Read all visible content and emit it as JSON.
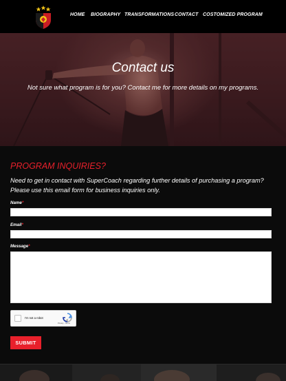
{
  "header": {
    "nav": [
      {
        "id": "home",
        "label": "HOME"
      },
      {
        "id": "biography",
        "label": "BIOGRAPHY"
      },
      {
        "id": "transformations",
        "label": "TRANSFORMATIONS"
      },
      {
        "id": "contact",
        "label": "CONTACT"
      },
      {
        "id": "customized",
        "label": "COSTOMIZED PROGRAM"
      }
    ],
    "logo_icon": "crest-logo-icon"
  },
  "hero": {
    "title": "Contact us",
    "subtitle": "Not sure what program is for you? Contact me for more details on my programs."
  },
  "form": {
    "title": "PROGRAM INQUIRIES?",
    "description": "Need to get in contact with SuperCoach regarding further details of purchasing a program? Please use this email form for business inquiries only.",
    "name_label": "Name",
    "email_label": "Email",
    "message_label": "Message",
    "required_mark": "*",
    "name_value": "",
    "email_value": "",
    "message_value": "",
    "recaptcha_label": "I'm not a robot",
    "recaptcha_terms": "Privacy - Terms",
    "submit_label": "SUBMIT"
  },
  "colors": {
    "accent": "#e8202b",
    "background": "#0b0b0b",
    "header": "#000000"
  }
}
